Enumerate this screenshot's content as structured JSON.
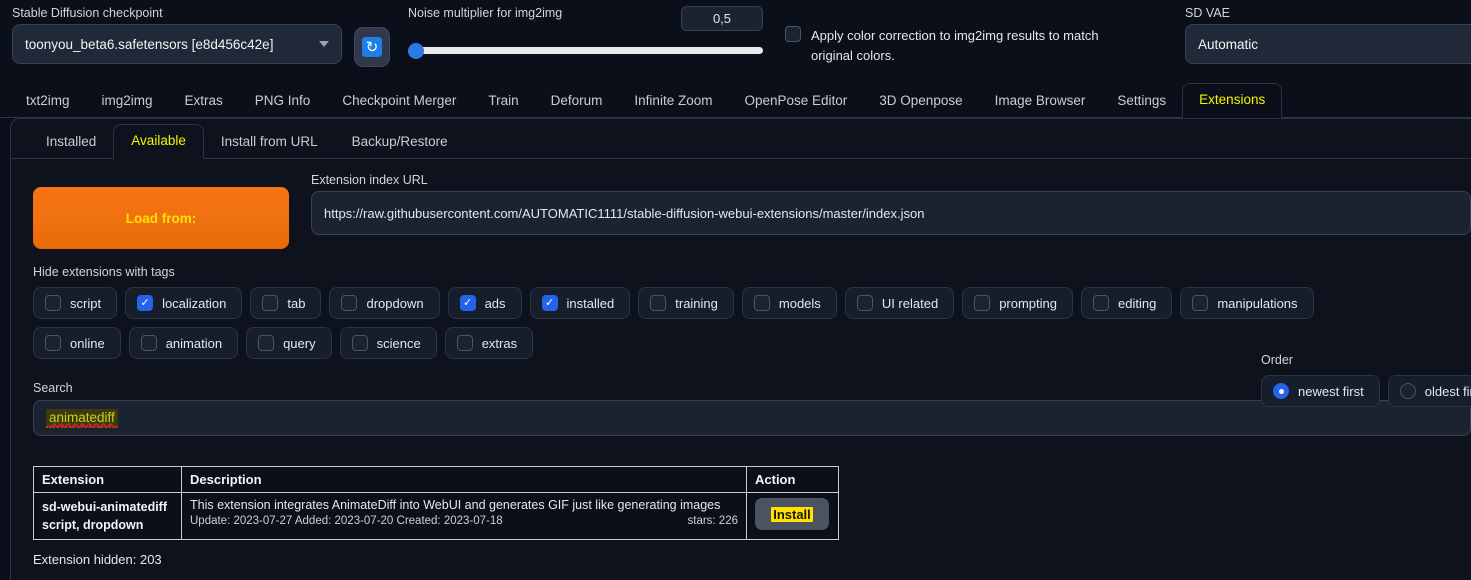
{
  "topbar": {
    "checkpoint": {
      "label": "Stable Diffusion checkpoint",
      "value": "toonyou_beta6.safetensors [e8d456c42e]"
    },
    "refresh": {
      "icon": "refresh-icon",
      "glyph": "↻"
    },
    "noise": {
      "label": "Noise multiplier for img2img",
      "value": "0,5"
    },
    "color_correction": {
      "label": "Apply color correction to img2img results to match original colors.",
      "checked": false
    },
    "vae": {
      "label": "SD VAE",
      "value": "Automatic"
    }
  },
  "main_tabs": [
    {
      "label": "txt2img",
      "active": false
    },
    {
      "label": "img2img",
      "active": false
    },
    {
      "label": "Extras",
      "active": false
    },
    {
      "label": "PNG Info",
      "active": false
    },
    {
      "label": "Checkpoint Merger",
      "active": false
    },
    {
      "label": "Train",
      "active": false
    },
    {
      "label": "Deforum",
      "active": false
    },
    {
      "label": "Infinite Zoom",
      "active": false
    },
    {
      "label": "OpenPose Editor",
      "active": false
    },
    {
      "label": "3D Openpose",
      "active": false
    },
    {
      "label": "Image Browser",
      "active": false
    },
    {
      "label": "Settings",
      "active": false
    },
    {
      "label": "Extensions",
      "active": true
    }
  ],
  "sub_tabs": [
    {
      "label": "Installed",
      "active": false
    },
    {
      "label": "Available",
      "active": true
    },
    {
      "label": "Install from URL",
      "active": false
    },
    {
      "label": "Backup/Restore",
      "active": false
    }
  ],
  "load": {
    "button_label": "Load from:"
  },
  "index_url": {
    "label": "Extension index URL",
    "value": "https://raw.githubusercontent.com/AUTOMATIC1111/stable-diffusion-webui-extensions/master/index.json"
  },
  "tags": {
    "label": "Hide extensions with tags",
    "row1": [
      {
        "label": "script",
        "checked": false
      },
      {
        "label": "localization",
        "checked": true
      },
      {
        "label": "tab",
        "checked": false
      },
      {
        "label": "dropdown",
        "checked": false
      },
      {
        "label": "ads",
        "checked": true
      },
      {
        "label": "installed",
        "checked": true
      },
      {
        "label": "training",
        "checked": false
      },
      {
        "label": "models",
        "checked": false
      },
      {
        "label": "UI related",
        "checked": false
      },
      {
        "label": "prompting",
        "checked": false
      },
      {
        "label": "editing",
        "checked": false
      },
      {
        "label": "manipulations",
        "checked": false
      }
    ],
    "row2": [
      {
        "label": "online",
        "checked": false
      },
      {
        "label": "animation",
        "checked": false
      },
      {
        "label": "query",
        "checked": false
      },
      {
        "label": "science",
        "checked": false
      },
      {
        "label": "extras",
        "checked": false
      }
    ]
  },
  "order": {
    "label": "Order",
    "options": [
      {
        "label": "newest first",
        "selected": true
      },
      {
        "label": "oldest first",
        "selected": false
      }
    ]
  },
  "search": {
    "label": "Search",
    "value": "animatediff"
  },
  "table": {
    "headers": {
      "extension": "Extension",
      "description": "Description",
      "action": "Action"
    },
    "rows": [
      {
        "name": "sd-webui-animatediff",
        "tags": "script, dropdown",
        "description": "This extension integrates AnimateDiff into WebUI and generates GIF just like generating images",
        "meta": "Update: 2023-07-27 Added: 2023-07-20 Created: 2023-07-18",
        "stars": "stars: 226",
        "action_label": "Install"
      }
    ]
  },
  "status": {
    "hidden_count": "Extension hidden: 203"
  },
  "colors": {
    "accent_orange": "#f97316",
    "accent_yellow": "#ffe000",
    "accent_blue": "#2563eb",
    "bg": "#0b0f19"
  }
}
